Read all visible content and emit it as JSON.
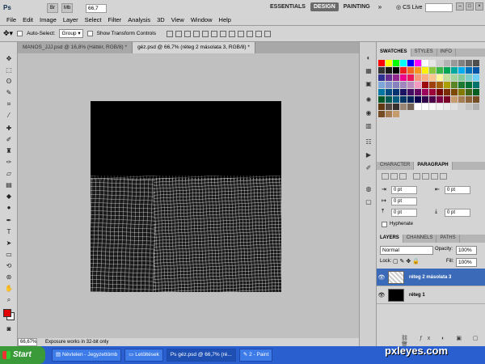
{
  "app": {
    "logo": "Ps",
    "zoom": "66,7",
    "menus": [
      "File",
      "Edit",
      "Image",
      "Layer",
      "Select",
      "Filter",
      "Analysis",
      "3D",
      "View",
      "Window",
      "Help"
    ],
    "workspaces": [
      "ESSENTIALS",
      "DESIGN",
      "PAINTING"
    ],
    "active_workspace": "DESIGN",
    "more": "»",
    "cs_live": "CS Live"
  },
  "options": {
    "auto_select_label": "Auto-Select:",
    "auto_select_value": "Group",
    "transform_label": "Show Transform Controls"
  },
  "doc_tabs": [
    "MANOS_JJJ.psd @ 16,8% (Háttér, RGB/8) *",
    "géz.psd @ 66,7% (réteg 2 másolata 3, RGB/8) *"
  ],
  "status": {
    "zoom": "66,67%",
    "message": "Exposure works in 32-bit only"
  },
  "panels": {
    "swatch_tabs": [
      "SWATCHES",
      "STYLES",
      "INFO"
    ],
    "char_tabs": [
      "CHARACTER",
      "PARAGRAPH"
    ],
    "para_fields": [
      "0 pt",
      "0 pt",
      "0 pt",
      "0 pt",
      "0 pt"
    ],
    "hyphenate": "Hyphenate",
    "layer_tabs": [
      "LAYERS",
      "CHANNELS",
      "PATHS"
    ],
    "blend_mode": "Normal",
    "opacity_label": "Opacity:",
    "opacity": "100%",
    "lock_label": "Lock:",
    "fill_label": "Fill:",
    "fill": "100%",
    "layers": [
      {
        "name": "réteg 2 másolata 3",
        "selected": true
      },
      {
        "name": "réteg 1",
        "selected": false
      }
    ]
  },
  "taskbar": {
    "start": "Start",
    "tasks": [
      "Névtelen - Jegyzettömb",
      "Letöltések",
      "géz.psd @ 66,7% (ré...",
      "2 - Paint"
    ]
  },
  "watermark": "pxleyes.com",
  "colors": {
    "foreground": "#e00000",
    "background": "#ffffff",
    "selection": "#3b6ab8"
  }
}
